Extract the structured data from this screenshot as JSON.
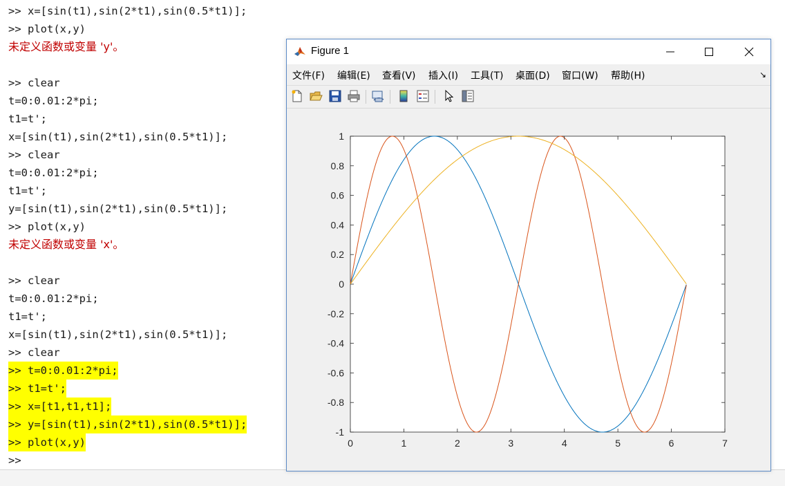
{
  "console": {
    "lines": [
      {
        "text": ">> x=[sin(t1),sin(2*t1),sin(0.5*t1)];",
        "type": "cmd"
      },
      {
        "text": ">> plot(x,y)",
        "type": "cmd"
      },
      {
        "text": "未定义函数或变量 'y'。",
        "type": "err"
      },
      {
        "text": "",
        "type": "blank"
      },
      {
        "text": ">> clear",
        "type": "cmd"
      },
      {
        "text": "t=0:0.01:2*pi;",
        "type": "cmd"
      },
      {
        "text": "t1=t';",
        "type": "cmd"
      },
      {
        "text": "x=[sin(t1),sin(2*t1),sin(0.5*t1)];",
        "type": "cmd"
      },
      {
        "text": ">> clear",
        "type": "cmd"
      },
      {
        "text": "t=0:0.01:2*pi;",
        "type": "cmd"
      },
      {
        "text": "t1=t';",
        "type": "cmd"
      },
      {
        "text": "y=[sin(t1),sin(2*t1),sin(0.5*t1)];",
        "type": "cmd"
      },
      {
        "text": ">> plot(x,y)",
        "type": "cmd"
      },
      {
        "text": "未定义函数或变量 'x'。",
        "type": "err"
      },
      {
        "text": "",
        "type": "blank"
      },
      {
        "text": ">> clear",
        "type": "cmd"
      },
      {
        "text": "t=0:0.01:2*pi;",
        "type": "cmd"
      },
      {
        "text": "t1=t';",
        "type": "cmd"
      },
      {
        "text": "x=[sin(t1),sin(2*t1),sin(0.5*t1)];",
        "type": "cmd"
      },
      {
        "text": ">> clear",
        "type": "cmd"
      },
      {
        "text": ">> t=0:0.01:2*pi;",
        "type": "hl"
      },
      {
        "text": ">> t1=t';",
        "type": "hl"
      },
      {
        "text": ">> x=[t1,t1,t1];",
        "type": "hl"
      },
      {
        "text": ">> y=[sin(t1),sin(2*t1),sin(0.5*t1)];",
        "type": "hl"
      },
      {
        "text": ">> plot(x,y)",
        "type": "hl"
      },
      {
        "text": ">>",
        "type": "cmd"
      }
    ],
    "highlight_color": "#ffff00",
    "error_color": "#c00000"
  },
  "figure": {
    "title": "Figure 1",
    "menu": [
      "文件(F)",
      "编辑(E)",
      "查看(V)",
      "插入(I)",
      "工具(T)",
      "桌面(D)",
      "窗口(W)",
      "帮助(H)"
    ],
    "menu_more": "↘",
    "toolbar_icons": [
      "new-figure-icon",
      "open-file-icon",
      "save-icon",
      "print-icon",
      "link-plot-icon",
      "colorbar-icon",
      "legend-icon",
      "pointer-icon",
      "property-inspector-icon"
    ]
  },
  "chart_data": {
    "type": "line",
    "title": "",
    "xlabel": "",
    "ylabel": "",
    "xlim": [
      0,
      7
    ],
    "ylim": [
      -1,
      1
    ],
    "xticks": [
      "0",
      "1",
      "2",
      "3",
      "4",
      "5",
      "6",
      "7"
    ],
    "yticks": [
      "-1",
      "-0.8",
      "-0.6",
      "-0.4",
      "-0.2",
      "0",
      "0.2",
      "0.4",
      "0.6",
      "0.8",
      "1"
    ],
    "x_range": [
      0,
      6.28
    ],
    "series": [
      {
        "function": "sin(t1)",
        "color": "#0072BD"
      },
      {
        "function": "sin(2*t1)",
        "color": "#D95319"
      },
      {
        "function": "sin(0.5*t1)",
        "color": "#EDB120"
      }
    ],
    "grid": false
  }
}
